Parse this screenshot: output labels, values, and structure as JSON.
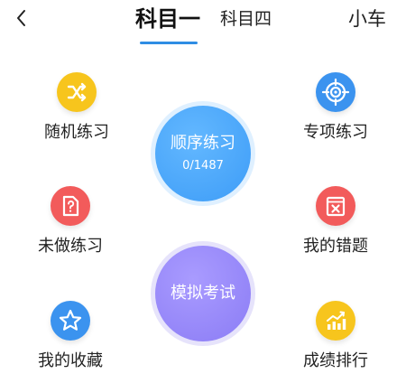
{
  "header": {
    "back_icon": "chevron-left-icon",
    "tabs": [
      {
        "label": "科目一",
        "active": true
      },
      {
        "label": "科目四",
        "active": false
      }
    ],
    "vehicle_label": "小车",
    "accent_color": "#2f8de4"
  },
  "features": {
    "random": {
      "label": "随机练习",
      "icon": "shuffle-icon",
      "color": "#f7c51d"
    },
    "special": {
      "label": "专项练习",
      "icon": "target-icon",
      "color": "#3b93ef"
    },
    "undone": {
      "label": "未做练习",
      "icon": "question-document-icon",
      "color": "#f25b5b"
    },
    "mistakes": {
      "label": "我的错题",
      "icon": "error-book-icon",
      "color": "#f25b5b"
    },
    "favorites": {
      "label": "我的收藏",
      "icon": "star-icon",
      "color": "#3b93ef"
    },
    "ranking": {
      "label": "成绩排行",
      "icon": "trend-chart-icon",
      "color": "#f7c51d"
    }
  },
  "sequential": {
    "title": "顺序练习",
    "progress": "0/1487",
    "color": "#4aa8fb"
  },
  "mock_exam": {
    "title": "模拟考试",
    "color": "#958af7"
  }
}
